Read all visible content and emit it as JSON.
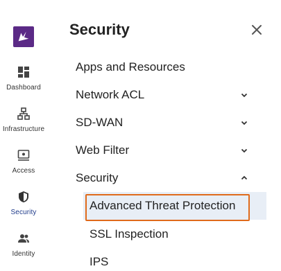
{
  "rail": {
    "logo_icon": "brand-logo-icon",
    "items": [
      {
        "label": "Dashboard",
        "icon": "dashboard-icon"
      },
      {
        "label": "Infrastructure",
        "icon": "infrastructure-icon"
      },
      {
        "label": "Access",
        "icon": "access-icon"
      },
      {
        "label": "Security",
        "icon": "shield-icon",
        "active": true
      },
      {
        "label": "Identity",
        "icon": "identity-icon"
      }
    ]
  },
  "panel": {
    "title": "Security",
    "close_icon": "close-icon",
    "items": [
      {
        "label": "Apps and Resources"
      },
      {
        "label": "Network ACL",
        "chevron": "chevron-down-icon"
      },
      {
        "label": "SD-WAN",
        "chevron": "chevron-down-icon"
      },
      {
        "label": "Web Filter",
        "chevron": "chevron-down-icon"
      },
      {
        "label": "Security",
        "chevron": "chevron-up-icon",
        "expanded": true
      }
    ],
    "security_subitems": [
      {
        "label": "Advanced Threat Protection",
        "selected": true
      },
      {
        "label": "SSL Inspection"
      },
      {
        "label": "IPS"
      }
    ]
  },
  "colors": {
    "brand": "#5b2a86",
    "active_rail_label": "#1e3a8a",
    "selected_bg": "#e8eef6",
    "highlight_outline": "#e06a1b"
  }
}
